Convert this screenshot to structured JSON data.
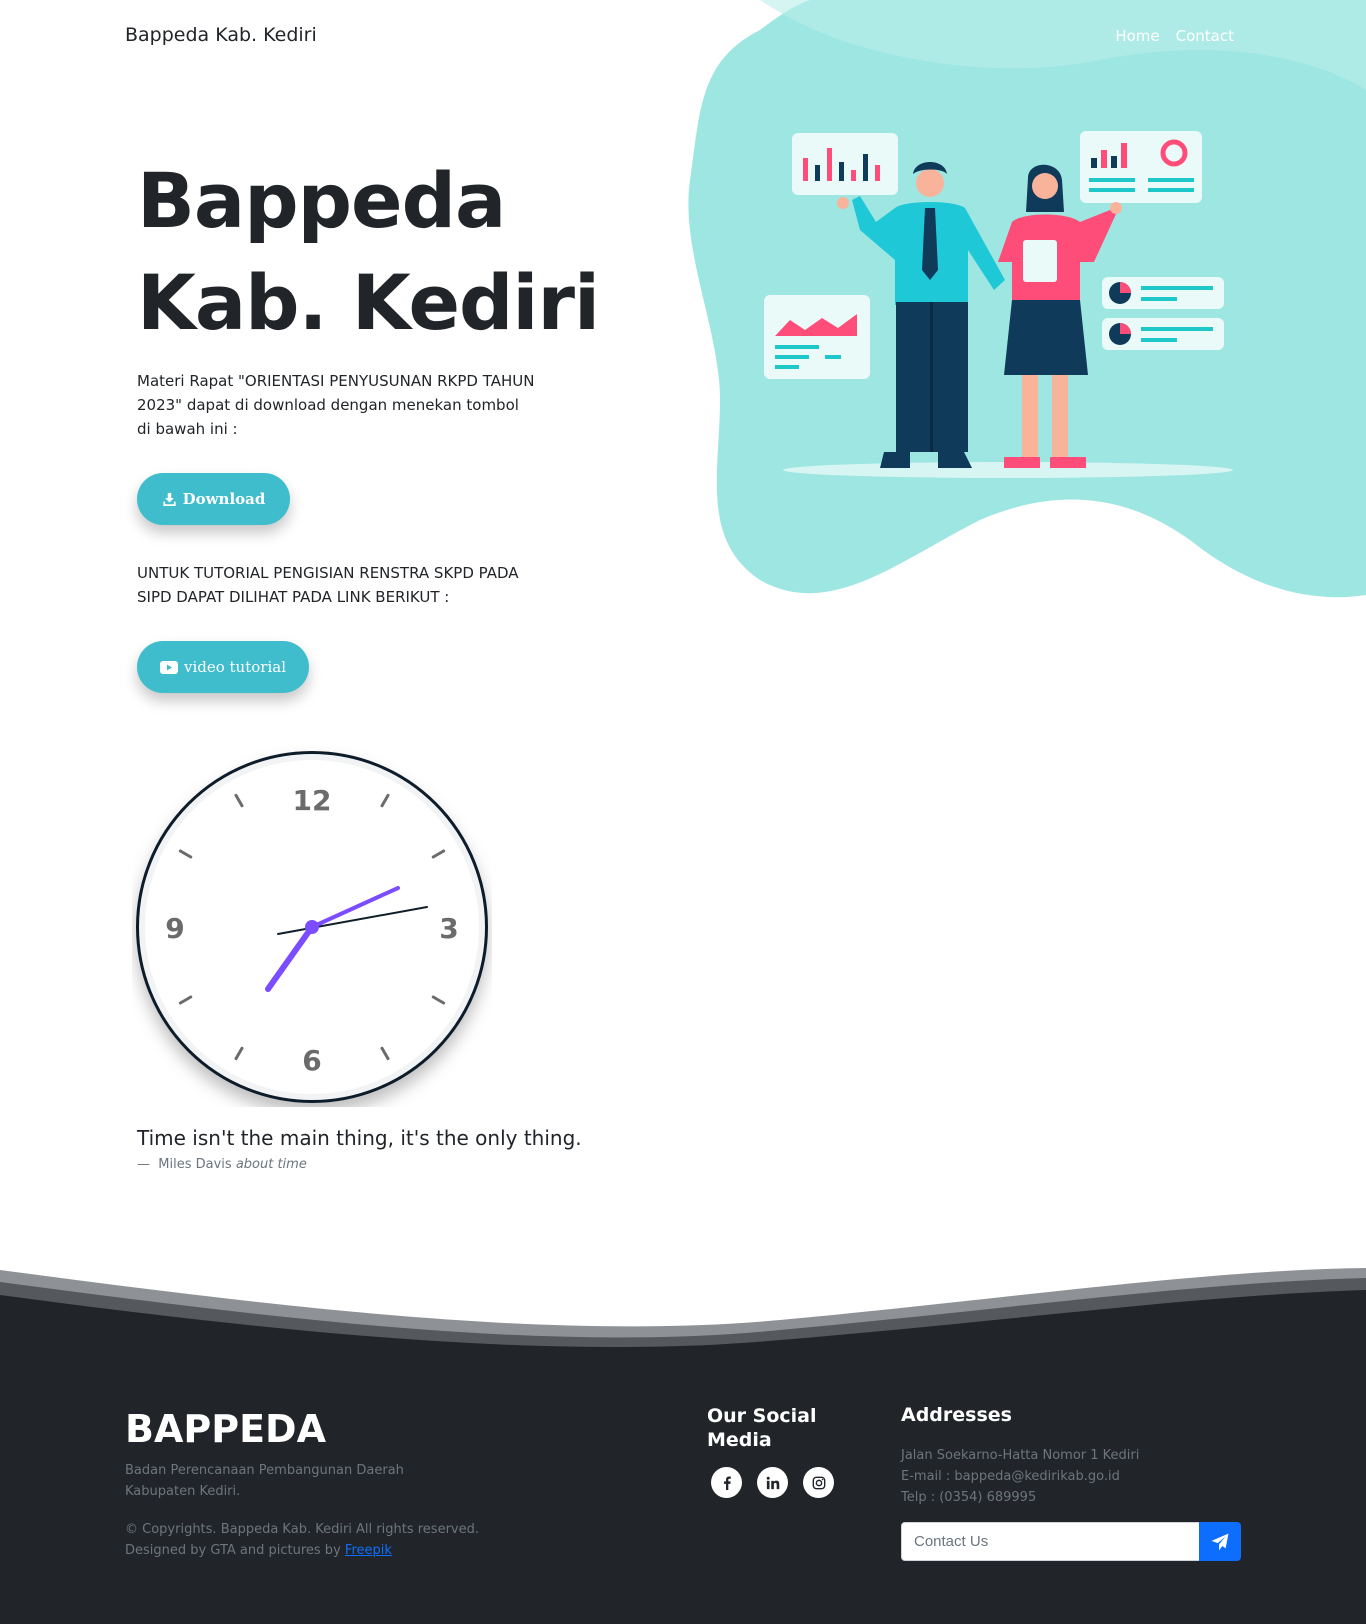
{
  "header": {
    "brand": "Bappeda Kab. Kediri",
    "nav": [
      "Home",
      "Contact"
    ]
  },
  "hero": {
    "title_line1": "Bappeda",
    "title_line2": "Kab. Kediri",
    "description": "Materi Rapat \"ORIENTASI PENYUSUNAN RKPD TAHUN 2023\" dapat di download dengan menekan tombol di bawah ini :",
    "download_label": "Download",
    "tutorial_text": "UNTUK TUTORIAL PENGISIAN RENSTRA SKPD PADA SIPD DAPAT DILIHAT PADA LINK BERIKUT :",
    "video_label": "video tutorial"
  },
  "clock": {
    "numbers": [
      "12",
      "3",
      "6",
      "9"
    ],
    "time": "7:12"
  },
  "quote": {
    "text": "Time isn't the main thing, it's the only thing.",
    "author": "Miles Davis",
    "source": "about time"
  },
  "footer": {
    "title": "BAPPEDA",
    "description": "Badan Perencanaan Pembangunan Daerah Kabupaten Kediri.",
    "copyright": "© Copyrights. Bappeda Kab. Kediri All rights reserved.",
    "designed_prefix": "Designed by GTA and pictures by",
    "designed_link": "Freepik",
    "social_title": "Our Social Media",
    "addresses_title": "Addresses",
    "address_line": "Jalan Soekarno-Hatta Nomor 1 Kediri",
    "email_line": "E-mail : bappeda@kedirikab.go.id",
    "phone_line": "Telp : (0354) 689995",
    "contact_placeholder": "Contact Us"
  },
  "colors": {
    "accent": "#3fbdcc",
    "blob": "#9ee6e2",
    "footer_bg": "#212529",
    "send_button": "#0d6efd",
    "clock_hand": "#7c4dff"
  }
}
